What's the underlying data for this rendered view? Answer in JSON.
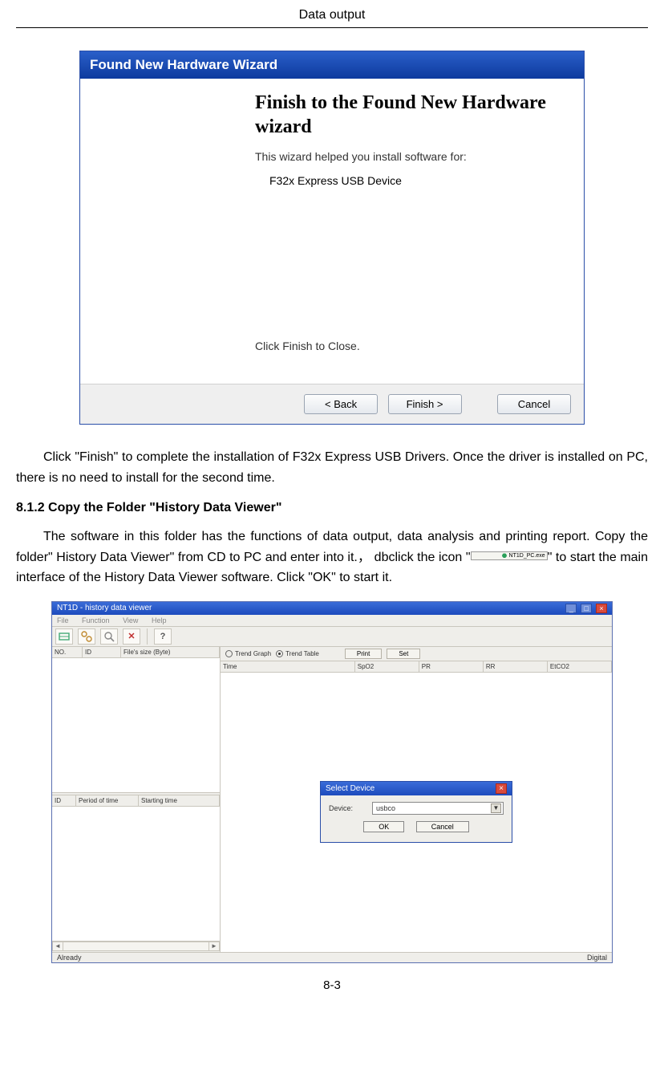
{
  "page": {
    "header": "Data output",
    "number": "8-3"
  },
  "wizard": {
    "titlebar": "Found New Hardware Wizard",
    "heading": "Finish to the Found New Hardware wizard",
    "helped_text": "This wizard helped you install software for:",
    "device": "F32x Express USB Device",
    "instruction": "Click Finish to Close.",
    "buttons": {
      "back": "< Back",
      "finish": "Finish >",
      "cancel": "Cancel"
    }
  },
  "paragraphs": {
    "p1": "Click \"Finish\" to complete the installation of F32x Express USB Drivers. Once the driver is installed on PC, there is no need to install for the second time.",
    "h812": "8.1.2 Copy the Folder \"History Data Viewer\"",
    "p2a": "The software in this folder has the functions of data output, data analysis and printing report. Copy the folder\" History Data Viewer\" from CD to PC and enter into it.， dbclick the icon \"",
    "icon_label": "NT1D_PC.exe",
    "p2b": "\" to start the main interface of the History Data Viewer software. Click \"OK\" to start it."
  },
  "app": {
    "title": "NT1D - history data viewer",
    "menu": {
      "m1": "File",
      "m2": "Function",
      "m3": "View",
      "m4": "Help"
    },
    "toolbar_question": "?",
    "tabs": {
      "trend_graph": "Trend Graph",
      "trend_table": "Trend Table",
      "print": "Print",
      "set": "Set"
    },
    "left_top_cols": {
      "c1": "NO.",
      "c2": "ID",
      "c3": "File's size (Byte)"
    },
    "left_bottom_cols": {
      "c1": "ID",
      "c2": "Period of time",
      "c3": "Starting time"
    },
    "right_cols": {
      "c1": "Time",
      "c2": "SpO2",
      "c3": "PR",
      "c4": "RR",
      "c5": "EtCO2"
    },
    "dialog": {
      "title": "Select Device",
      "label": "Device:",
      "value": "usbco",
      "ok": "OK",
      "cancel": "Cancel"
    },
    "status_left": "Already",
    "status_right": "Digital"
  }
}
